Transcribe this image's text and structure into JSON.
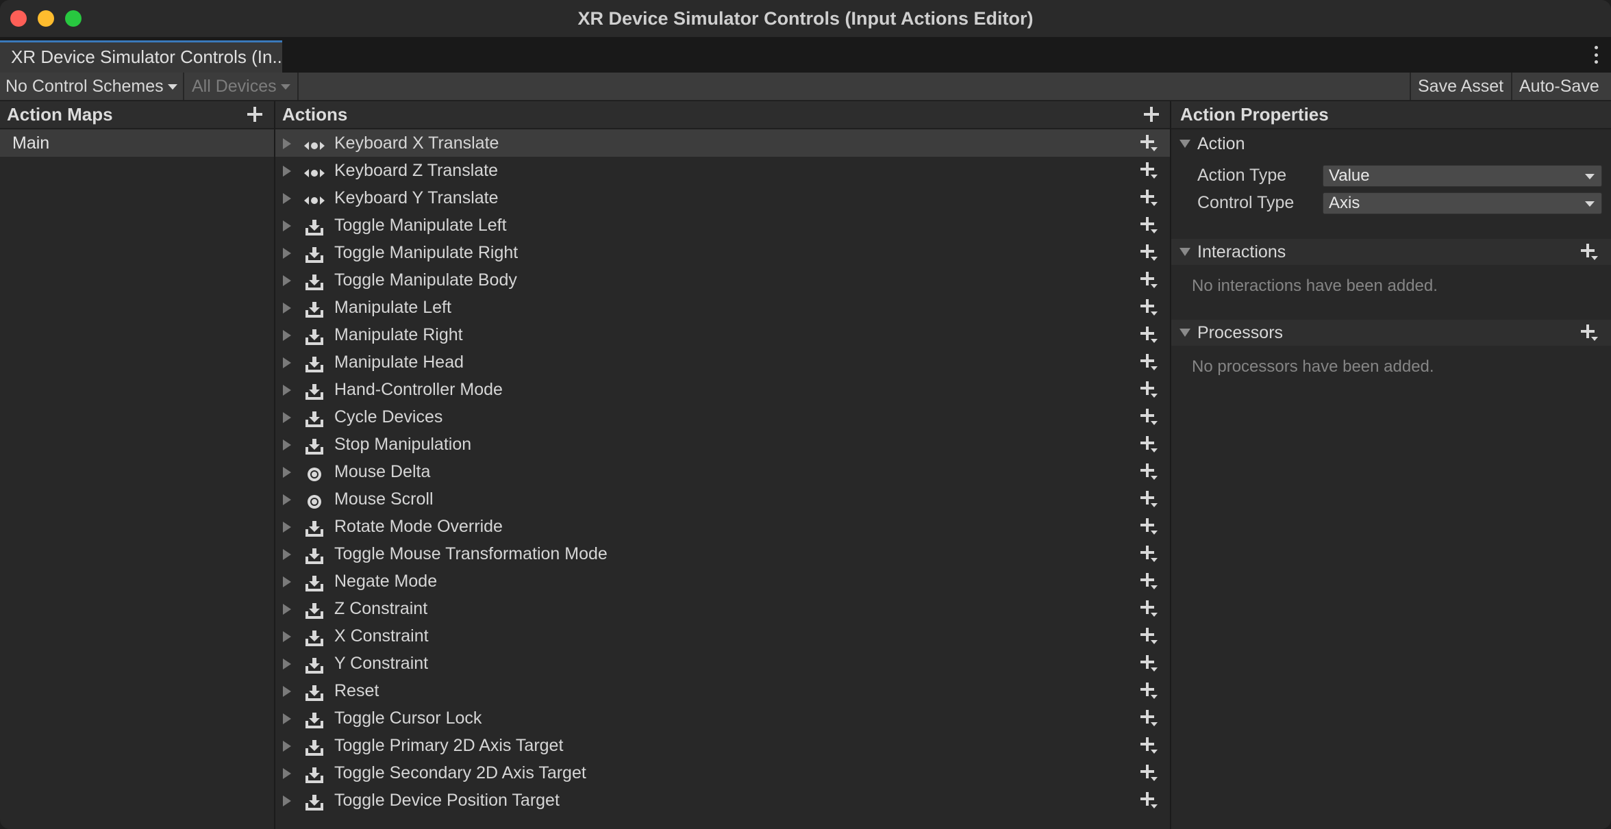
{
  "window": {
    "title": "XR Device Simulator Controls (Input Actions Editor)",
    "tab_label": "XR Device Simulator Controls (In..."
  },
  "toolbar": {
    "control_schemes": "No Control Schemes",
    "devices": "All Devices",
    "save_asset": "Save Asset",
    "auto_save": "Auto-Save"
  },
  "action_maps": {
    "title": "Action Maps",
    "items": [
      "Main"
    ],
    "selected": "Main"
  },
  "actions": {
    "title": "Actions",
    "items": [
      {
        "label": "Keyboard X Translate",
        "icon": "composite-axis-icon"
      },
      {
        "label": "Keyboard Z Translate",
        "icon": "composite-axis-icon"
      },
      {
        "label": "Keyboard Y Translate",
        "icon": "composite-axis-icon"
      },
      {
        "label": "Toggle Manipulate Left",
        "icon": "button-action-icon"
      },
      {
        "label": "Toggle Manipulate Right",
        "icon": "button-action-icon"
      },
      {
        "label": "Toggle Manipulate Body",
        "icon": "button-action-icon"
      },
      {
        "label": "Manipulate Left",
        "icon": "button-action-icon"
      },
      {
        "label": "Manipulate Right",
        "icon": "button-action-icon"
      },
      {
        "label": "Manipulate Head",
        "icon": "button-action-icon"
      },
      {
        "label": "Hand-Controller Mode",
        "icon": "button-action-icon"
      },
      {
        "label": "Cycle Devices",
        "icon": "button-action-icon"
      },
      {
        "label": "Stop Manipulation",
        "icon": "button-action-icon"
      },
      {
        "label": "Mouse Delta",
        "icon": "passthrough-action-icon"
      },
      {
        "label": "Mouse Scroll",
        "icon": "passthrough-action-icon"
      },
      {
        "label": "Rotate Mode Override",
        "icon": "button-action-icon"
      },
      {
        "label": "Toggle Mouse Transformation Mode",
        "icon": "button-action-icon"
      },
      {
        "label": "Negate Mode",
        "icon": "button-action-icon"
      },
      {
        "label": "Z Constraint",
        "icon": "button-action-icon"
      },
      {
        "label": "X Constraint",
        "icon": "button-action-icon"
      },
      {
        "label": "Y Constraint",
        "icon": "button-action-icon"
      },
      {
        "label": "Reset",
        "icon": "button-action-icon"
      },
      {
        "label": "Toggle Cursor Lock",
        "icon": "button-action-icon"
      },
      {
        "label": "Toggle Primary 2D Axis Target",
        "icon": "button-action-icon"
      },
      {
        "label": "Toggle Secondary 2D Axis Target",
        "icon": "button-action-icon"
      },
      {
        "label": "Toggle Device Position Target",
        "icon": "button-action-icon"
      }
    ],
    "selected_index": 0
  },
  "properties": {
    "title": "Action Properties",
    "action_section": "Action",
    "action_type_label": "Action Type",
    "action_type_value": "Value",
    "control_type_label": "Control Type",
    "control_type_value": "Axis",
    "interactions_section": "Interactions",
    "interactions_empty": "No interactions have been added.",
    "processors_section": "Processors",
    "processors_empty": "No processors have been added."
  },
  "colors": {
    "accent": "#3a79bb",
    "close": "#fe5f57",
    "minimize": "#febc2e",
    "zoom": "#28c840"
  }
}
